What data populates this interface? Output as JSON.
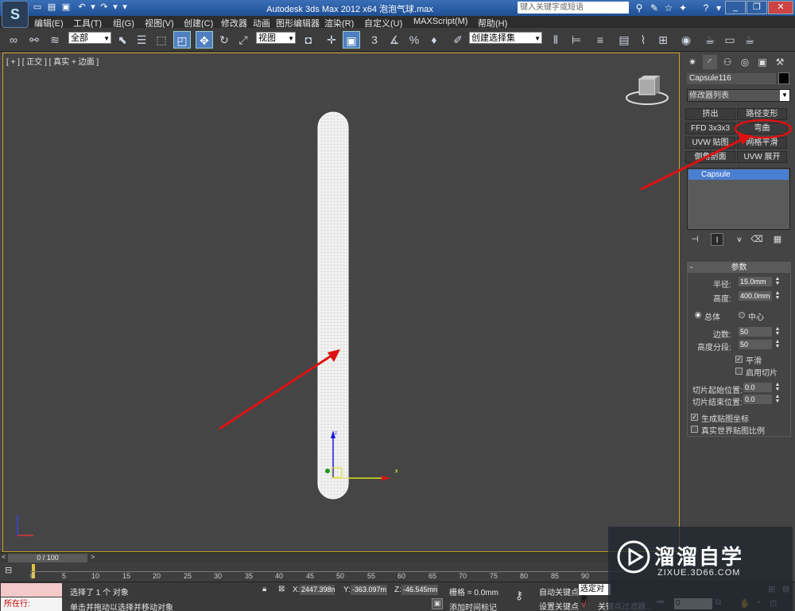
{
  "titlebar": {
    "title": "Autodesk 3ds Max  2012 x64     泡泡气球.max",
    "search_placeholder": "键入关键字或短语",
    "app_logo_letter": "S"
  },
  "menu": [
    "编辑(E)",
    "工具(T)",
    "组(G)",
    "视图(V)",
    "创建(C)",
    "修改器",
    "动画",
    "图形编辑器",
    "渲染(R)",
    "自定义(U)",
    "MAXScript(M)",
    "帮助(H)"
  ],
  "toolbar": {
    "selection_filter": "全部",
    "ref_coord": "视图",
    "named_selection": "创建选择集",
    "snap_angle_label": "3"
  },
  "viewport": {
    "label": "[ + ] [ 正交 ] [ 真实 + 边面 ]",
    "axis_x": "x",
    "axis_z": "z"
  },
  "command_panel": {
    "object_name": "Capsule116",
    "object_color": "#000000",
    "modifier_list": "修改器列表",
    "modifier_buttons": [
      "挤出",
      "路径变形",
      "FFD 3x3x3",
      "弯曲",
      "UVW 贴图",
      "网格平滑",
      "倒角剖面",
      "UVW 展开"
    ],
    "stack_item": "Capsule",
    "rollout_title": "参数",
    "radius_label": "半径:",
    "radius_value": "15.0mm",
    "height_label": "高度:",
    "height_value": "400.0mm",
    "radio_overall": "总体",
    "radio_center": "中心",
    "sides_label": "边数:",
    "sides_value": "50",
    "height_segs_label": "高度分段:",
    "height_segs_value": "50",
    "smooth_label": "平滑",
    "slice_on_label": "启用切片",
    "slice_from_label": "切片起始位置:",
    "slice_from_value": "0.0",
    "slice_to_label": "切片结束位置:",
    "slice_to_value": "0.0",
    "gen_map_coords_label": "生成贴图坐标",
    "real_world_label": "真实世界贴图比例"
  },
  "timeline": {
    "slider": "0 / 100",
    "ticks": [
      "0",
      "5",
      "10",
      "15",
      "20",
      "25",
      "30",
      "35",
      "40",
      "45",
      "50",
      "55",
      "60",
      "65",
      "70",
      "75",
      "80",
      "85",
      "90"
    ]
  },
  "status": {
    "running": "所在行:",
    "selection": "选择了 1 个 对象",
    "prompt": "单击并拖动以选择并移动对象",
    "x_label": "X:",
    "x_value": "2447.398n",
    "y_label": "Y:",
    "y_value": "-363.097m",
    "z_label": "Z:",
    "z_value": "-46.545mn",
    "grid": "栅格 = 0.0mm",
    "add_time_tag": "添加时间标记",
    "auto_key": "自动关键点",
    "set_key": "设置关键点",
    "selected_object": "选定对象",
    "key_filters": "关键点过滤器...",
    "frame": "0"
  },
  "watermark": {
    "brand": "溜溜自学",
    "url": "ZIXUE.3D66.COM"
  },
  "colors": {
    "annotation": "#dd1111",
    "viewport_border": "#c9a22a",
    "selection_blue": "#4a7ed1"
  }
}
